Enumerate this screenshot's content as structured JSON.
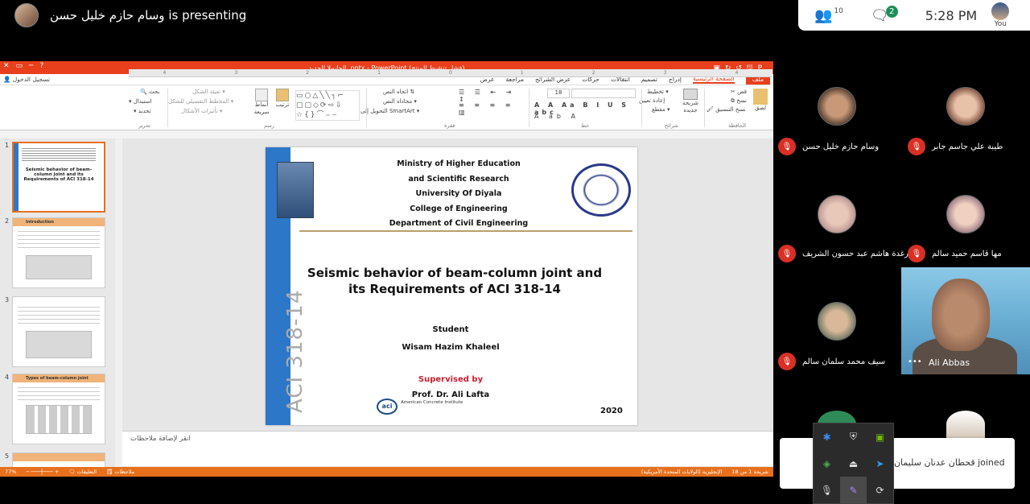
{
  "header": {
    "presenter_text": "وسام حازم خليل حسن is presenting",
    "participants_count": "10",
    "chat_badge": "2",
    "time": "5:28 PM",
    "you_label": "You"
  },
  "ppt": {
    "window_title": "الحايملا الجديد .pptx - PowerPoint (فشل تنشيط المنتج)",
    "tabs": [
      "ملف",
      "الصفحة الرئيسية",
      "إدراج",
      "تصميم",
      "انتقالات",
      "حركات",
      "عرض الشرائح",
      "مراجعة",
      "عرض"
    ],
    "login": "تسجيل الدخول",
    "ribbon": {
      "clipboard": {
        "label": "الحافظة",
        "paste": "لصق",
        "cut": "قص",
        "copy": "نسخ",
        "format": "نسخ التنسيق"
      },
      "slides": {
        "label": "شرائح",
        "new": "شريحة جديدة",
        "layout": "تخطيط",
        "reset": "إعادة تعيين",
        "section": "مقطع"
      },
      "font": {
        "label": "خط",
        "size": "18"
      },
      "paragraph": {
        "label": "فقرة",
        "dir": "اتجاه النص",
        "align": "محاذاة النص",
        "smartart": "التحويل إلى SmartArt"
      },
      "drawing": {
        "label": "رسم",
        "arrange": "ترتيب",
        "quick": "أنماط سريعة",
        "fill": "تعبئة الشكل",
        "outline": "المخطط التفصيلي للشكل",
        "effects": "تأثيرات الأشكال"
      },
      "editing": {
        "label": "تحرير",
        "find": "بحث",
        "replace": "استبدال",
        "select": "تحديد"
      }
    },
    "ruler_marks": [
      "4",
      "3",
      "2",
      "1",
      "0",
      "1",
      "2",
      "3",
      "4"
    ],
    "thumbnails": [
      {
        "num": "1",
        "title": "Seismic behavior of beam-column joint and its Requirements of ACI 318-14"
      },
      {
        "num": "2",
        "title": "Introduction"
      },
      {
        "num": "3",
        "title": ""
      },
      {
        "num": "4",
        "title": "Types of beam-column joint"
      },
      {
        "num": "5",
        "title": ""
      }
    ],
    "slide": {
      "ministry_lines": [
        "Ministry of Higher Education",
        "and Scientific Research",
        "University Of Diyala",
        "College of Engineering",
        "Department of Civil Engineering"
      ],
      "title_line1": "Seismic behavior of beam-column joint and",
      "title_line2": "its Requirements of ACI 318-14",
      "vertical_text": "ACI 318-14",
      "student_label": "Student",
      "student_name": "Wisam Hazim Khaleel",
      "supervised_label": "Supervised by",
      "supervisor": "Prof. Dr. Ali Lafta",
      "aci_logo": "aci",
      "aci_text": "American Concrete Institute",
      "year": "2020"
    },
    "notes_placeholder": "انقر لإضافة ملاحظات",
    "status": {
      "slide_info": "شريحة 1 من 18",
      "language": "الإنجليزية (الولايات المتحدة الأمريكية)",
      "notes": "ملاحظات",
      "comments": "التعليقات",
      "zoom": "77%"
    }
  },
  "participants": [
    {
      "name": "طيبة علي جاسم جابر"
    },
    {
      "name": "وسام حازم خليل حسن"
    },
    {
      "name": "مها قاسم حميد سالم"
    },
    {
      "name": "رغدة هاشم عبد حسون الشريف"
    },
    {
      "name": "سيف محمد سلمان سالم"
    }
  ],
  "video_tile": {
    "name": "Ali Abbas"
  },
  "toast": {
    "message": "قحطان عدنان سليمان قـ joined"
  }
}
